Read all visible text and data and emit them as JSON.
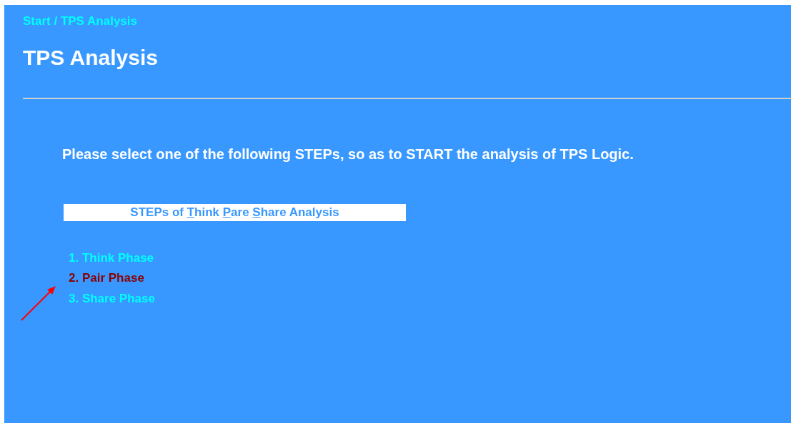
{
  "breadcrumb": "Start / TPS Analysis",
  "title": "TPS Analysis",
  "instruction": "Please select one of the following STEPs, so as to START the analysis of TPS Logic.",
  "steps_heading": [
    {
      "text": "STEPs of ",
      "underlined": false
    },
    {
      "text": "T",
      "underlined": true
    },
    {
      "text": "hink ",
      "underlined": false
    },
    {
      "text": "P",
      "underlined": true
    },
    {
      "text": "are ",
      "underlined": false
    },
    {
      "text": "S",
      "underlined": true
    },
    {
      "text": "hare Analysis",
      "underlined": false
    }
  ],
  "steps": [
    {
      "label": "1. Think Phase",
      "selected": false
    },
    {
      "label": "2. Pair Phase",
      "selected": true
    },
    {
      "label": "3. Share Phase",
      "selected": false
    }
  ]
}
